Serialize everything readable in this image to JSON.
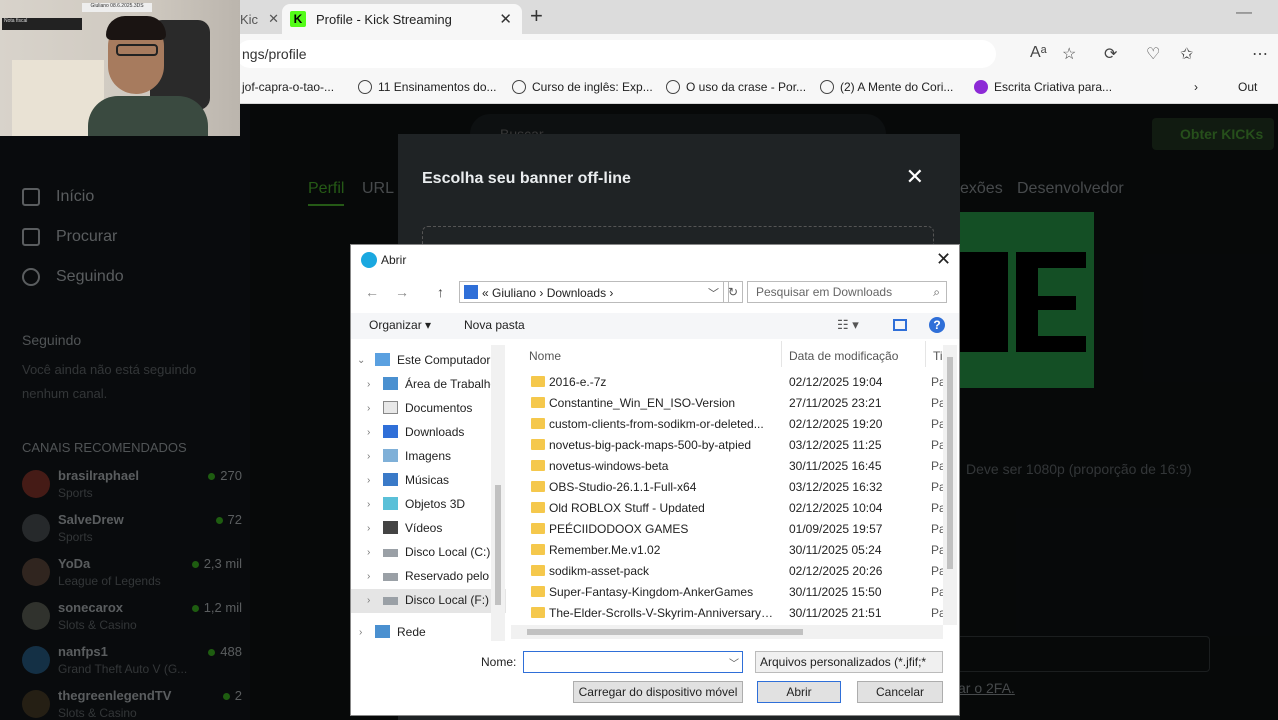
{
  "browser": {
    "prev_tab_fragment": "Kic",
    "active_tab_title": "Profile - Kick Streaming",
    "kick_favicon": "K",
    "url_fragment": "ngs/profile",
    "bookmarks": [
      {
        "label": "jof-capra-o-tao-..."
      },
      {
        "label": "11 Ensinamentos do..."
      },
      {
        "label": "Curso de inglês: Exp..."
      },
      {
        "label": "O uso da crase - Por..."
      },
      {
        "label": "(2) A Mente do Cori..."
      },
      {
        "label": "Escrita Criativa para..."
      }
    ],
    "overflow_label": "Out"
  },
  "kick": {
    "search_placeholder": "Buscar",
    "get_kicks": "Obter KICKs",
    "nav": [
      {
        "label": "Início",
        "icon": "home-icon"
      },
      {
        "label": "Procurar",
        "icon": "browse-icon"
      },
      {
        "label": "Seguindo",
        "icon": "heart-icon"
      }
    ],
    "following_heading": "Seguindo",
    "following_empty": "Você ainda não está seguindo nenhum canal.",
    "recommended_heading": "CANAIS RECOMENDADOS",
    "channels": [
      {
        "name": "brasilraphael",
        "category": "Sports",
        "viewers": "270"
      },
      {
        "name": "SalveDrew",
        "category": "Sports",
        "viewers": "72"
      },
      {
        "name": "YoDa",
        "category": "League of Legends",
        "viewers": "2,3 mil"
      },
      {
        "name": "sonecarox",
        "category": "Slots & Casino",
        "viewers": "1,2 mil"
      },
      {
        "name": "nanfps1",
        "category": "Grand Theft Auto V (G...",
        "viewers": "488"
      },
      {
        "name": "thegreenlegendTV",
        "category": "Slots & Casino",
        "viewers": "2"
      }
    ],
    "profile_tabs": {
      "perfil": "Perfil",
      "url": "URL",
      "conexoes": "exões",
      "dev": "Desenvolvedor"
    },
    "banner_hint": "Deve ser 1080p (proporção de 16:9)",
    "twofa_link": "ar o 2FA.",
    "brand_green": "#53fc18"
  },
  "modal": {
    "title": "Escolha seu banner off-line"
  },
  "dialog": {
    "title": "Abrir",
    "breadcrumb": "«  Giuliano  ›  Downloads  ›",
    "search_placeholder": "Pesquisar em Downloads",
    "organize": "Organizar ▾",
    "new_folder": "Nova pasta",
    "tree": [
      {
        "label": "Este Computador",
        "icon": "computer-icon"
      },
      {
        "label": "Área de Trabalho",
        "icon": "desktop-icon"
      },
      {
        "label": "Documentos",
        "icon": "documents-icon"
      },
      {
        "label": "Downloads",
        "icon": "downloads-icon"
      },
      {
        "label": "Imagens",
        "icon": "images-icon"
      },
      {
        "label": "Músicas",
        "icon": "music-icon"
      },
      {
        "label": "Objetos 3D",
        "icon": "3d-objects-icon"
      },
      {
        "label": "Vídeos",
        "icon": "videos-icon"
      },
      {
        "label": "Disco Local (C:)",
        "icon": "drive-icon"
      },
      {
        "label": "Reservado pelo S",
        "icon": "drive-icon"
      },
      {
        "label": "Disco Local (F:)",
        "icon": "drive-icon"
      },
      {
        "label": "Rede",
        "icon": "network-icon"
      }
    ],
    "columns": {
      "name": "Nome",
      "date": "Data de modificação",
      "type": "Ti"
    },
    "files": [
      {
        "name": "2016-e.-7z",
        "date": "02/12/2025 19:04",
        "type": "Pa"
      },
      {
        "name": "Constantine_Win_EN_ISO-Version",
        "date": "27/11/2025 23:21",
        "type": "Pa"
      },
      {
        "name": "custom-clients-from-sodikm-or-deleted...",
        "date": "02/12/2025 19:20",
        "type": "Pa"
      },
      {
        "name": "novetus-big-pack-maps-500-by-atpied",
        "date": "03/12/2025 11:25",
        "type": "Pa"
      },
      {
        "name": "novetus-windows-beta",
        "date": "30/11/2025 16:45",
        "type": "Pa"
      },
      {
        "name": "OBS-Studio-26.1.1-Full-x64",
        "date": "03/12/2025 16:32",
        "type": "Pa"
      },
      {
        "name": "Old ROBLOX Stuff - Updated",
        "date": "02/12/2025 10:04",
        "type": "Pa"
      },
      {
        "name": "PEÉCIIDODOOX GAMES",
        "date": "01/09/2025 19:57",
        "type": "Pa"
      },
      {
        "name": "Remember.Me.v1.02",
        "date": "30/11/2025 05:24",
        "type": "Pa"
      },
      {
        "name": "sodikm-asset-pack",
        "date": "02/12/2025 20:26",
        "type": "Pa"
      },
      {
        "name": "Super-Fantasy-Kingdom-AnkerGames",
        "date": "30/11/2025 15:50",
        "type": "Pa"
      },
      {
        "name": "The-Elder-Scrolls-V-Skyrim-Anniversary-...",
        "date": "30/11/2025 21:51",
        "type": "Pa"
      }
    ],
    "name_label": "Nome:",
    "filetype": "Arquivos personalizados (*.jfif;*",
    "btn_mobile": "Carregar do dispositivo móvel",
    "btn_open": "Abrir",
    "btn_cancel": "Cancelar"
  },
  "webcam": {
    "note_top": "Giuliano 08.6.2025.3DS",
    "note_left": "Nota fiscal"
  }
}
